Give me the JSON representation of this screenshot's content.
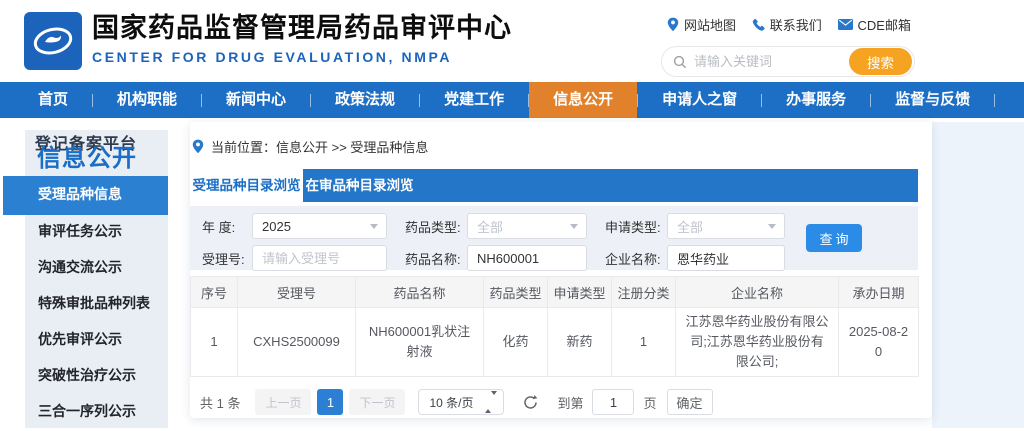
{
  "header": {
    "title": "国家药品监督管理局药品审评中心",
    "subtitle": "CENTER FOR DRUG EVALUATION, NMPA",
    "links": [
      {
        "label": "网站地图",
        "icon": "location-pin-icon"
      },
      {
        "label": "联系我们",
        "icon": "phone-icon"
      },
      {
        "label": "CDE邮箱",
        "icon": "mail-icon"
      }
    ],
    "search": {
      "placeholder": "请输入关键词",
      "button_label": "搜索"
    }
  },
  "nav": {
    "items": [
      {
        "label": "首页",
        "active": false
      },
      {
        "label": "机构职能",
        "active": false
      },
      {
        "label": "新闻中心",
        "active": false
      },
      {
        "label": "政策法规",
        "active": false
      },
      {
        "label": "党建工作",
        "active": false
      },
      {
        "label": "信息公开",
        "active": true
      },
      {
        "label": "申请人之窗",
        "active": false
      },
      {
        "label": "办事服务",
        "active": false
      },
      {
        "label": "监督与反馈",
        "active": false
      }
    ]
  },
  "sidebar": {
    "backdrop_text": "登记备案平台",
    "title": "信息公开",
    "items": [
      {
        "label": "受理品种信息",
        "active": true
      },
      {
        "label": "审评任务公示",
        "active": false
      },
      {
        "label": "沟通交流公示",
        "active": false
      },
      {
        "label": "特殊审批品种列表",
        "active": false
      },
      {
        "label": "优先审评公示",
        "active": false
      },
      {
        "label": "突破性治疗公示",
        "active": false
      },
      {
        "label": "三合一序列公示",
        "active": false
      }
    ]
  },
  "breadcrumb": {
    "label": "当前位置：信息公开 >> 受理品种信息"
  },
  "tabs": [
    {
      "label": "受理品种目录浏览",
      "active": true
    },
    {
      "label": "在审品种目录浏览",
      "active": false
    }
  ],
  "filters": {
    "year": {
      "label": "年 度:",
      "value": "2025"
    },
    "drug_type": {
      "label": "药品类型:",
      "value": "全部"
    },
    "apply_type": {
      "label": "申请类型:",
      "value": "全部"
    },
    "acceptance_no": {
      "label": "受理号:",
      "placeholder": "请输入受理号",
      "value": ""
    },
    "drug_name": {
      "label": "药品名称:",
      "value": "NH600001"
    },
    "company": {
      "label": "企业名称:",
      "value": "恩华药业"
    },
    "query_label": "查询"
  },
  "table": {
    "headers": [
      "序号",
      "受理号",
      "药品名称",
      "药品类型",
      "申请类型",
      "注册分类",
      "企业名称",
      "承办日期"
    ],
    "rows": [
      [
        "1",
        "CXHS2500099",
        "NH600001乳状注射液",
        "化药",
        "新药",
        "1",
        "江苏恩华药业股份有限公司;江苏恩华药业股份有限公司;",
        "2025-08-20"
      ]
    ]
  },
  "pagination": {
    "total": "共 1 条",
    "prev": "上一页",
    "page": "1",
    "next": "下一页",
    "page_size": "10 条/页",
    "goto_prefix": "到第",
    "goto_value": "1",
    "goto_suffix": "页",
    "confirm": "确定"
  },
  "colors": {
    "nav_blue": "#1d6fc5",
    "nav_active_orange": "#e2812b",
    "search_button_orange": "#f6a322",
    "tab_blue": "#2476c8",
    "sidebar_active_blue": "#2b80d2",
    "query_button_blue": "#2b8ce8",
    "page_number_blue": "#2b7fd4",
    "subtitle_blue": "#1b64bc",
    "panel_bg": "#edf1f7",
    "right_panel_bg": "#edf3fb"
  }
}
